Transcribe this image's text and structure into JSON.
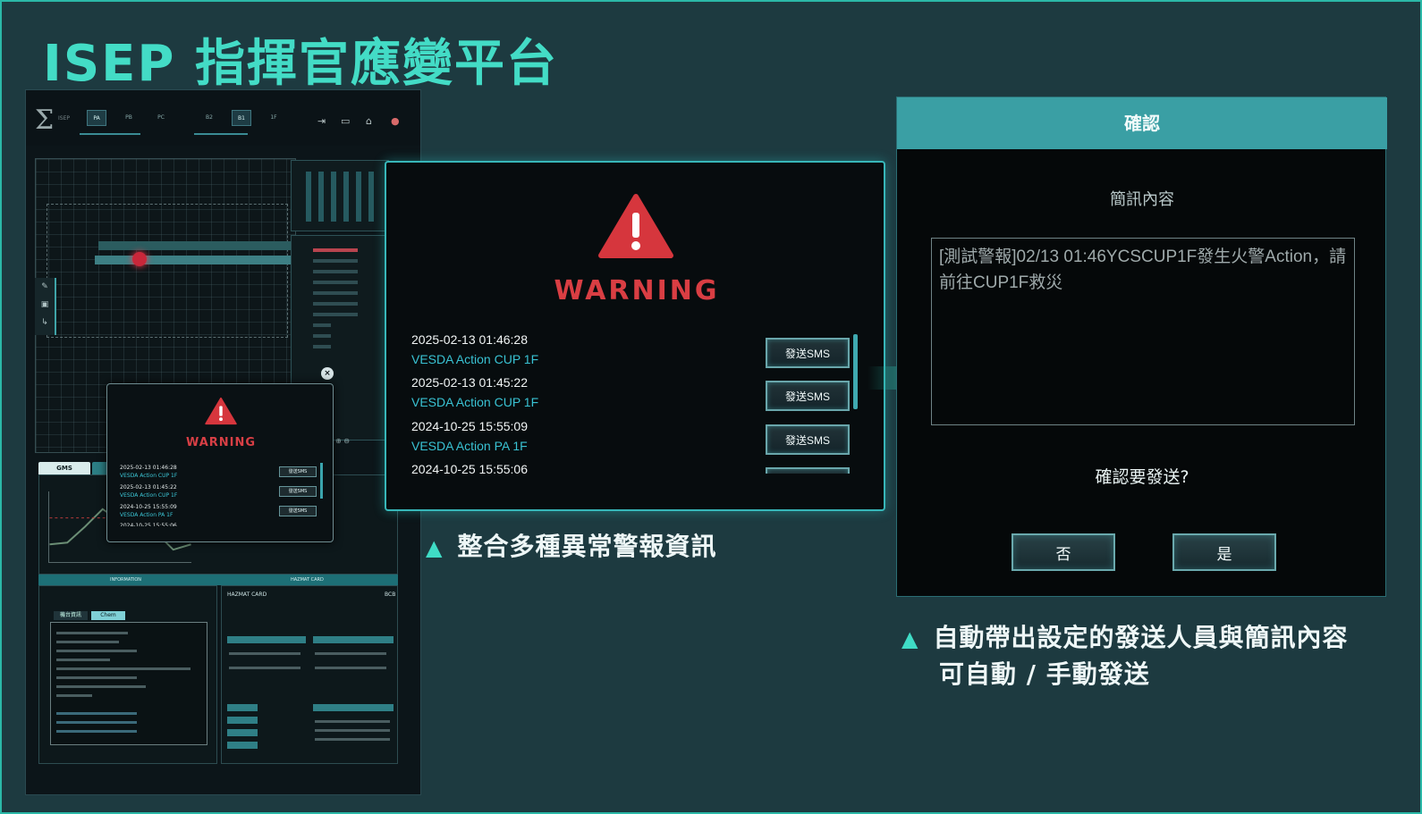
{
  "slide": {
    "title": "ISEP 指揮官應變平台",
    "caption_left": "整合多種異常警報資訊",
    "caption_right_line1": "自動帶出設定的發送人員與簡訊內容",
    "caption_right_line2": "可自動 / 手動發送",
    "triangle_glyph": "▲"
  },
  "dashboard": {
    "logo_glyph": "Σ",
    "logo_text": "ISEP",
    "floor_tabs": [
      "PA",
      "PB",
      "PC",
      "B2",
      "B1",
      "1F"
    ],
    "active_floor_tabs": [
      "PA",
      "B1"
    ],
    "gms_tab": "GMS",
    "information_header": "INFORMATION",
    "hazmat_header": "HAZMAT CARD",
    "hazmat_title": "HAZMAT CARD",
    "hazmat_code": "BCB",
    "info_tabs": [
      "機台資訊",
      "Chem"
    ]
  },
  "mini_warning": {
    "title": "WARNING",
    "entries": [
      {
        "time": "2025-02-13 01:46:28",
        "desc": "VESDA Action CUP 1F"
      },
      {
        "time": "2025-02-13 01:45:22",
        "desc": "VESDA Action CUP 1F"
      },
      {
        "time": "2024-10-25 15:55:09",
        "desc": "VESDA Action PA 1F"
      },
      {
        "time": "2024-10-25 15:55:06",
        "desc": ""
      }
    ],
    "sms_label": "發送SMS"
  },
  "warning_popup": {
    "icon": "warning-triangle-icon",
    "title": "WARNING",
    "entries": [
      {
        "time": "2025-02-13 01:46:28",
        "desc": "VESDA Action CUP 1F",
        "sms_label": "發送SMS"
      },
      {
        "time": "2025-02-13 01:45:22",
        "desc": "VESDA Action CUP 1F",
        "sms_label": "發送SMS"
      },
      {
        "time": "2024-10-25 15:55:09",
        "desc": "VESDA Action PA 1F",
        "sms_label": "發送SMS"
      },
      {
        "time": "2024-10-25 15:55:06",
        "desc": "",
        "sms_label": ""
      }
    ]
  },
  "confirm_dialog": {
    "title": "確認",
    "content_label": "簡訊內容",
    "message": "[測試警報]02/13 01:46YCSCUP1F發生火警Action，請前往CUP1F救災",
    "question": "確認要發送?",
    "no_label": "否",
    "yes_label": "是"
  },
  "colors": {
    "accent": "#43dcc6",
    "warning_red": "#d93e43",
    "link_cyan": "#39c2d3",
    "dialog_header": "#3a9fa4"
  }
}
